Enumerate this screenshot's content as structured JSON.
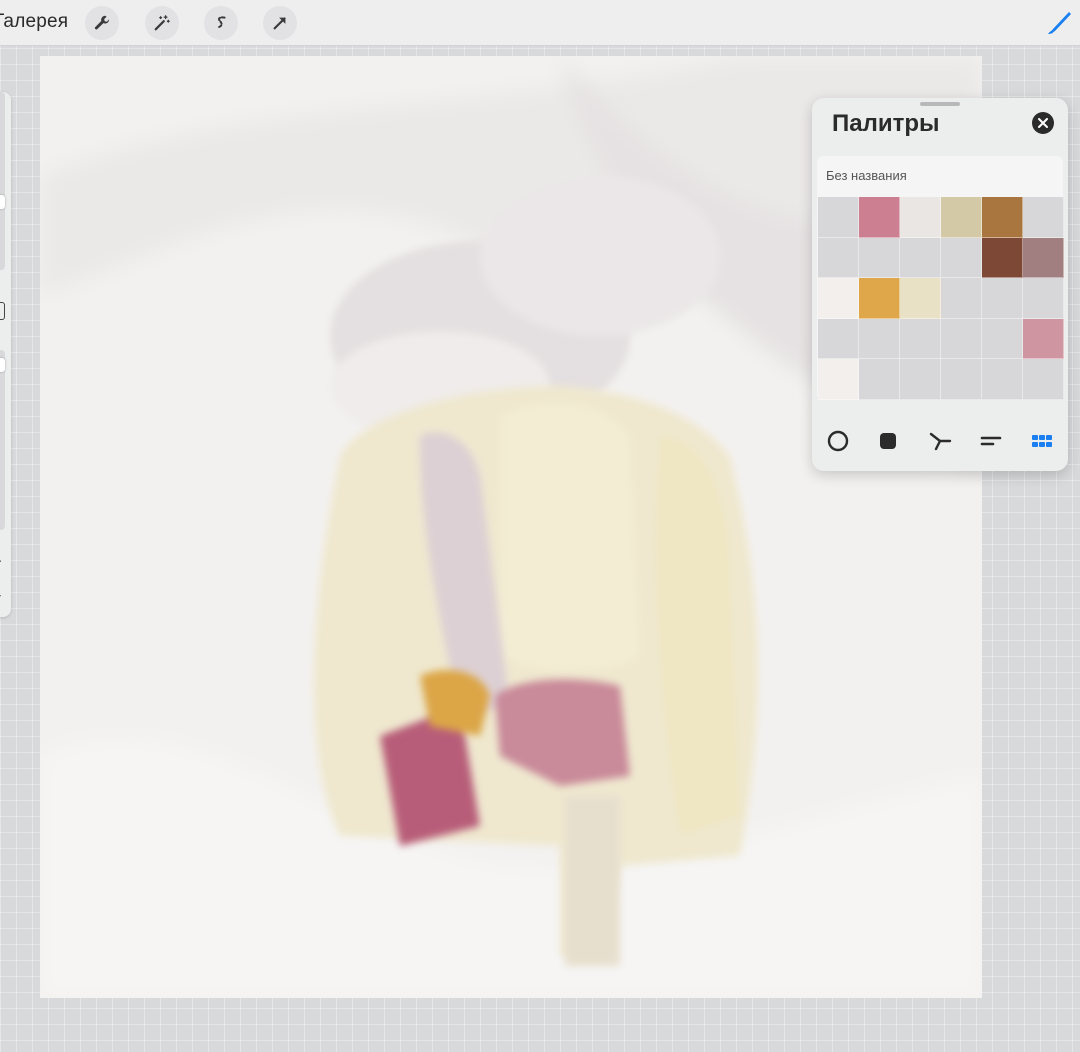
{
  "topbar": {
    "gallery_label": "Галерея",
    "tools": [
      {
        "name": "wrench-icon"
      },
      {
        "name": "magic-wand-icon"
      },
      {
        "name": "selection-s-icon"
      },
      {
        "name": "transform-arrow-icon"
      }
    ],
    "active_tool": "brush-icon",
    "accent_color": "#1a7ff0"
  },
  "palettes_panel": {
    "title": "Палитры",
    "palette_name": "Без названия",
    "swatches": [
      "#d7d7d9",
      "#cd7f92",
      "#e9e6e3",
      "#d4c9a7",
      "#a9763f",
      "#d7d7d9",
      "#d7d7d9",
      "#d7d7d9",
      "#d7d7d9",
      "#d7d7d9",
      "#7e4836",
      "#a17f80",
      "#f2efec",
      "#e0a74a",
      "#e9e1c5",
      "#d7d7d9",
      "#d7d7d9",
      "#d7d7d9",
      "#d7d7d9",
      "#d7d7d9",
      "#d7d7d9",
      "#d7d7d9",
      "#d7d7d9",
      "#cf96a1",
      "#f2efec",
      "#d7d7d9",
      "#d7d7d9",
      "#d7d7d9",
      "#d7d7d9",
      "#d7d7d9"
    ],
    "modes": [
      "disc-mode-icon",
      "classic-mode-icon",
      "harmony-mode-icon",
      "value-mode-icon",
      "palettes-mode-icon"
    ],
    "active_mode": "palettes-mode-icon"
  }
}
